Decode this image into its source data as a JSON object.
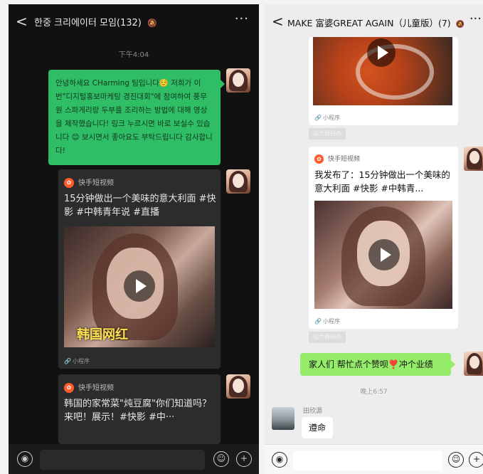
{
  "left": {
    "header": {
      "back": "<",
      "title": "한중 크리에이터 모임(132)",
      "mute_icon": "bell-off-icon",
      "more": "···"
    },
    "time": "下午4:04",
    "message": "안녕하세요 CHarming 팀입니다☺️ 저희가 이번\"디지털홍보마케팅 경진대회\"에 참여하여 풍무원 스파게리랑 두부를 조리하는 방법에 대해 영상을 제작했습니다! 링크 누르시면 바로 보실수 있습니다 😊 보시면서 좋아요도 부탁드립니다 감사합니다!",
    "card1": {
      "source": "快手短视频",
      "title": "15分钟做出一个美味的意大利面 #快影 #中韩青年说 #直播",
      "overlay": "韩国网红",
      "mini_program": "小程序"
    },
    "card2": {
      "source": "快手短视频",
      "title": "韩国的家常菜\"炖豆腐\"你们知道吗？来吧！展示！#快影 #中···"
    }
  },
  "right": {
    "header": {
      "back": "<",
      "title": "MAKE 富婆GREAT AGAIN（儿童版）(7)",
      "mute_icon": "bell-off-icon",
      "more": "···"
    },
    "card1": {
      "mini_program": "小程序",
      "share": "设为群待办"
    },
    "card2": {
      "source": "快手短视频",
      "title": "我发布了：15分钟做出一个美味的意大利面 #快影 #中韩青...",
      "mini_program": "小程序",
      "share": "设为群待办"
    },
    "own_message": "家人们 帮忙点个赞呗❣️冲个业绩",
    "time": "晚上6:57",
    "sender": "田欣源",
    "reply": "遵命"
  },
  "colors": {
    "dark_bubble": "#2fbd66",
    "light_bubble": "#95ec69",
    "dark_bg": "#111111",
    "light_bg": "#ededed"
  }
}
